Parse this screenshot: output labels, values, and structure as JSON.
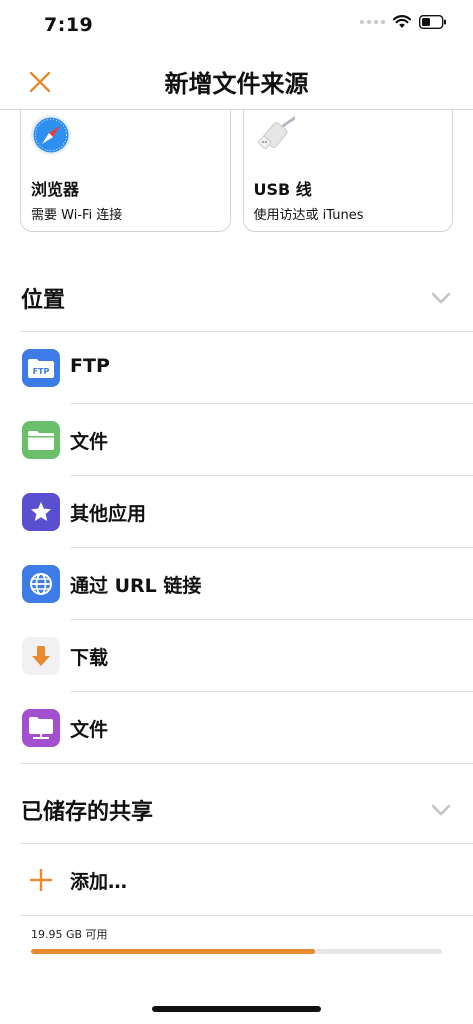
{
  "status": {
    "time": "7:19"
  },
  "nav": {
    "title": "新增文件来源"
  },
  "sources": [
    {
      "title": "浏览器",
      "subtitle": "需要 Wi-Fi 连接",
      "icon": "safari-compass-icon"
    },
    {
      "title": "USB 线",
      "subtitle": "使用访达或 iTunes",
      "icon": "usb-cable-icon"
    }
  ],
  "locations": {
    "title": "位置",
    "items": [
      {
        "label": "FTP",
        "icon": "ftp-folder-icon",
        "color": "#3d7be6",
        "badge": "FTP"
      },
      {
        "label": "文件",
        "icon": "files-folder-icon",
        "color": "#6bbf6a"
      },
      {
        "label": "其他应用",
        "icon": "star-icon",
        "color": "#5a4fd0"
      },
      {
        "label": "通过 URL 链接",
        "icon": "globe-icon",
        "color": "#3d7be6"
      },
      {
        "label": "下载",
        "icon": "download-arrow-icon",
        "color": "#e98a2f"
      },
      {
        "label": "文件",
        "icon": "network-folder-icon",
        "color": "#a24fd0"
      }
    ]
  },
  "shares": {
    "title": "已储存的共享",
    "add_label": "添加…"
  },
  "storage": {
    "text": "19.95 GB 可用",
    "used_fraction": 0.69
  },
  "accent": "#e98a2f"
}
